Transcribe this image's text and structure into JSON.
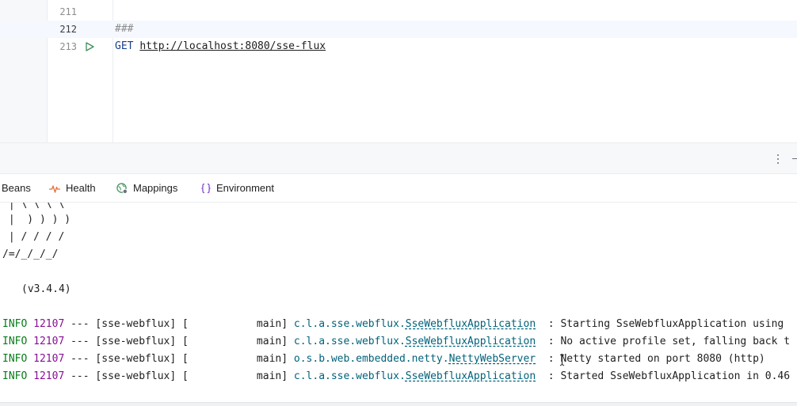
{
  "editor": {
    "lines": [
      {
        "number": "211",
        "text": ""
      },
      {
        "number": "212",
        "text": "###"
      },
      {
        "number": "213",
        "method": "GET",
        "url": "http://localhost:8080/sse-flux"
      }
    ],
    "run_icon": "run-triangle-icon"
  },
  "tabs": [
    {
      "label": "Beans",
      "icon": ""
    },
    {
      "label": "Health",
      "icon": "health-pulse-icon"
    },
    {
      "label": "Mappings",
      "icon": "mappings-globe-icon"
    },
    {
      "label": "Environment",
      "icon": "environment-braces-icon"
    }
  ],
  "console": {
    "banner": [
      " | \\ \\ \\ \\",
      " |  ) ) ) )",
      " | / / / /",
      "/=/_/_/_/"
    ],
    "version": "(v3.4.4)",
    "logs": [
      {
        "level": "INFO",
        "pid": "12107",
        "sep": " --- ",
        "app": "[sse-webflux]",
        "thread": " [           main] ",
        "logger_pkg": "c.l.a.sse.webflux.",
        "logger_cls": "SseWebfluxApplication",
        "message": "  : Starting SseWebfluxApplication using"
      },
      {
        "level": "INFO",
        "pid": "12107",
        "sep": " --- ",
        "app": "[sse-webflux]",
        "thread": " [           main] ",
        "logger_pkg": "c.l.a.sse.webflux.",
        "logger_cls": "SseWebfluxApplication",
        "message": "  : No active profile set, falling back t"
      },
      {
        "level": "INFO",
        "pid": "12107",
        "sep": " --- ",
        "app": "[sse-webflux]",
        "thread": " [           main] ",
        "logger_pkg": "o.s.b.web.embedded.netty.",
        "logger_cls": "NettyWebServer",
        "message": "  : Netty started on port 8080 (http)"
      },
      {
        "level": "INFO",
        "pid": "12107",
        "sep": " --- ",
        "app": "[sse-webflux]",
        "thread": " [           main] ",
        "logger_pkg": "c.l.a.sse.webflux.",
        "logger_cls": "SseWebfluxApplication",
        "message": "  : Started SseWebfluxApplication in 0.46"
      }
    ]
  },
  "colors": {
    "info": "#067d17",
    "pid": "#871094",
    "logger": "#00627a"
  }
}
